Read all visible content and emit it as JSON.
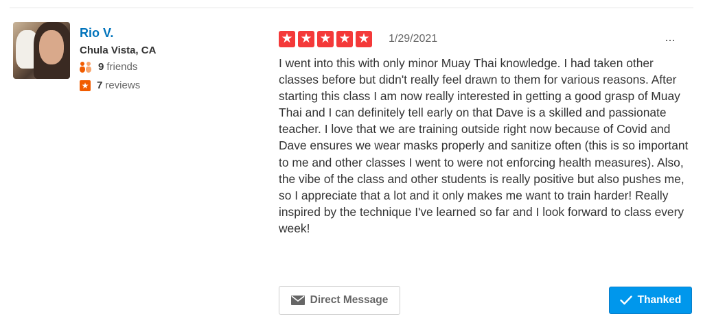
{
  "user": {
    "name": "Rio V.",
    "location": "Chula Vista, CA",
    "friends_count": "9",
    "friends_label": "friends",
    "reviews_count": "7",
    "reviews_label": "reviews"
  },
  "review": {
    "rating": 5,
    "date": "1/29/2021",
    "more_icon": "···",
    "text": "I went into this with only minor Muay Thai knowledge. I had taken other classes before but didn't really feel drawn to them for various reasons. After starting this class I am now really interested in getting a good grasp of Muay Thai and I can definitely tell early on that Dave is a skilled and passionate teacher. I love that we are training outside right now because of Covid and Dave ensures we wear masks properly and sanitize often (this is so important to me and other classes I went to were not enforcing health measures). Also, the vibe of the class and other students is really positive but also pushes me, so I appreciate that a lot and it only makes me want to train harder! Really inspired by the technique I've learned so far and I look forward to class every week!"
  },
  "actions": {
    "direct_message_label": "Direct Message",
    "thanked_label": "Thanked"
  },
  "icons": {
    "friends": "friends-icon",
    "reviews": "star-badge-icon",
    "rating_star": "star-icon",
    "message": "envelope-icon",
    "thanked": "checkmark-icon",
    "more": "more-options-icon"
  },
  "colors": {
    "accent_link": "#0073bb",
    "star_red": "#f43939",
    "orange": "#f15c00",
    "thanked_blue": "#0097ec"
  }
}
